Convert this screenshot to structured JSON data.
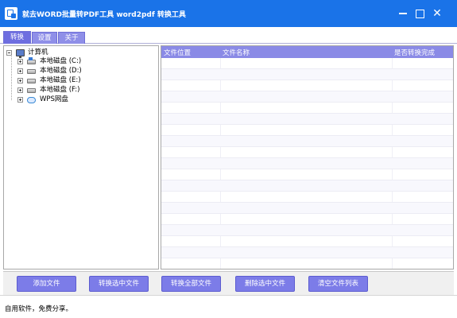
{
  "window": {
    "title": "就去WORD批量转PDF工具 word2pdf 转换工具",
    "minimize": "minimize",
    "maximize": "maximize",
    "close": "✕"
  },
  "tabs": [
    {
      "label": "转换",
      "active": true
    },
    {
      "label": "设置",
      "active": false
    },
    {
      "label": "关于",
      "active": false
    }
  ],
  "tree": {
    "root": {
      "label": "计算机",
      "icon": "computer-icon"
    },
    "items": [
      {
        "label": "本地磁盘 (C:)",
        "icon": "system-disk-icon"
      },
      {
        "label": "本地磁盘 (D:)",
        "icon": "disk-icon"
      },
      {
        "label": "本地磁盘 (E:)",
        "icon": "disk-icon"
      },
      {
        "label": "本地磁盘 (F:)",
        "icon": "disk-icon"
      },
      {
        "label": "WPS网盘",
        "icon": "cloud-drive-icon"
      }
    ]
  },
  "file_list": {
    "columns": [
      "文件位置",
      "文件名称",
      "是否转换完成"
    ],
    "rows": []
  },
  "buttons": {
    "add_files": "添加文件",
    "convert_selected": "转换选中文件",
    "convert_all": "转换全部文件",
    "delete_selected": "删除选中文件",
    "clear_list": "清空文件列表"
  },
  "status": {
    "text": "自用软件，免费分享。"
  },
  "colors": {
    "titlebar": "#1a73e8",
    "accent": "#7c7ce8",
    "header": "#8a8ae6"
  }
}
